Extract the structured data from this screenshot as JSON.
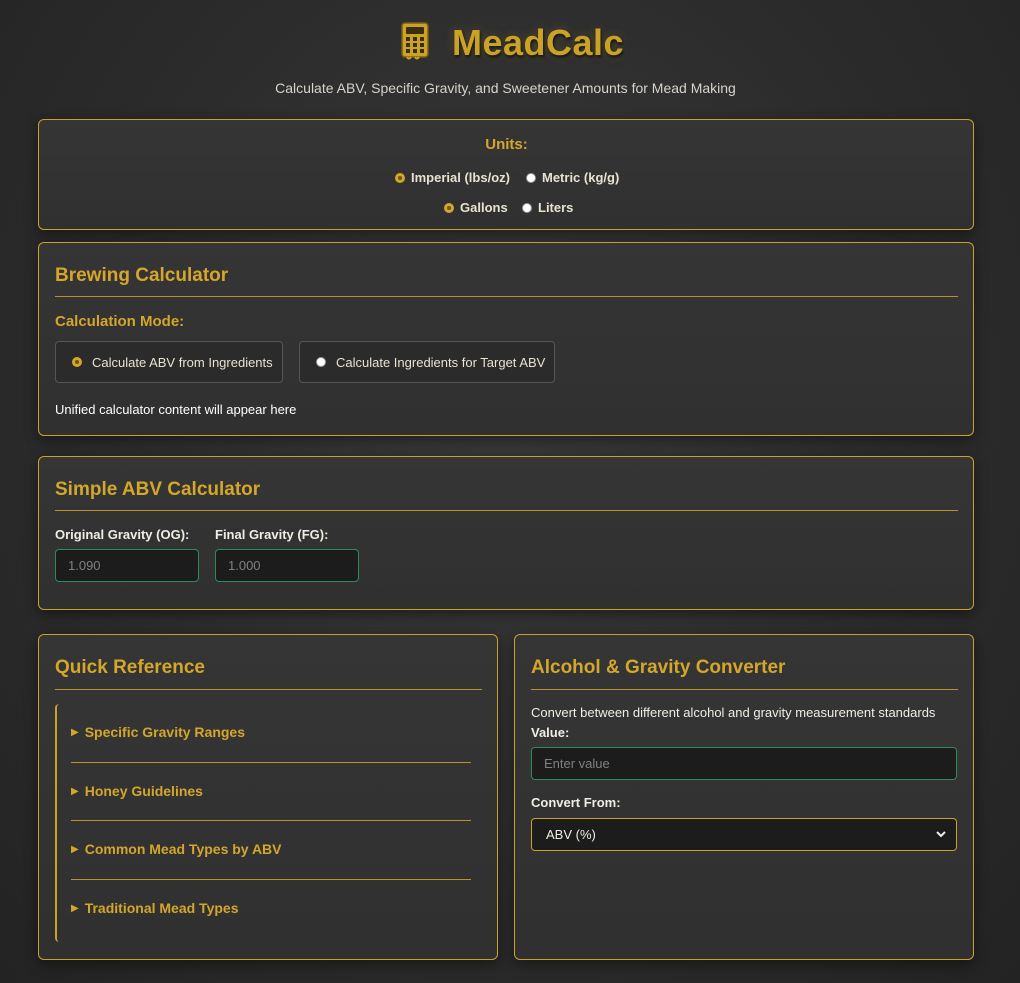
{
  "header": {
    "title": "MeadCalc",
    "subtitle": "Calculate ABV, Specific Gravity, and Sweetener Amounts for Mead Making",
    "logo_icon": "calculator-icon"
  },
  "units": {
    "title": "Units:",
    "weight_options": [
      {
        "label": "Imperial (lbs/oz)",
        "checked": true
      },
      {
        "label": "Metric (kg/g)",
        "checked": false
      }
    ],
    "volume_options": [
      {
        "label": "Gallons",
        "checked": true
      },
      {
        "label": "Liters",
        "checked": false
      }
    ]
  },
  "brewing": {
    "title": "Brewing Calculator",
    "mode_label": "Calculation Mode:",
    "modes": [
      {
        "label": "Calculate ABV from Ingredients",
        "checked": true
      },
      {
        "label": "Calculate Ingredients for Target ABV",
        "checked": false
      }
    ],
    "placeholder_text": "Unified calculator content will appear here"
  },
  "simple_abv": {
    "title": "Simple ABV Calculator",
    "og_label": "Original Gravity (OG):",
    "og_placeholder": "1.090",
    "fg_label": "Final Gravity (FG):",
    "fg_placeholder": "1.000"
  },
  "quick_reference": {
    "title": "Quick Reference",
    "items": [
      "Specific Gravity Ranges",
      "Honey Guidelines",
      "Common Mead Types by ABV",
      "Traditional Mead Types"
    ]
  },
  "converter": {
    "title": "Alcohol & Gravity Converter",
    "description": "Convert between different alcohol and gravity measurement standards",
    "value_label": "Value:",
    "value_placeholder": "Enter value",
    "from_label": "Convert From:",
    "from_selected": "ABV (%)"
  },
  "colors": {
    "accent_gold": "#d4a62a",
    "input_border_green": "#2d8a5a",
    "background": "#2c2c2c"
  }
}
